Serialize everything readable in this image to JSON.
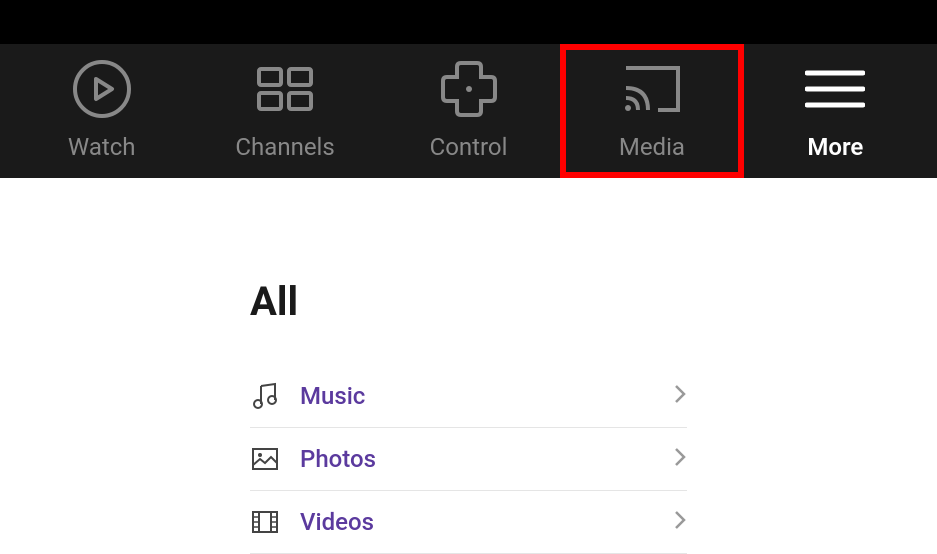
{
  "nav": {
    "items": [
      {
        "label": "Watch",
        "icon": "play-circle-icon"
      },
      {
        "label": "Channels",
        "icon": "grid-icon"
      },
      {
        "label": "Control",
        "icon": "dpad-icon"
      },
      {
        "label": "Media",
        "icon": "cast-icon",
        "highlighted": true
      },
      {
        "label": "More",
        "icon": "hamburger-icon",
        "active": true
      }
    ]
  },
  "content": {
    "section_title": "All",
    "list": [
      {
        "label": "Music",
        "icon": "music-icon"
      },
      {
        "label": "Photos",
        "icon": "photo-icon"
      },
      {
        "label": "Videos",
        "icon": "video-icon"
      }
    ]
  },
  "colors": {
    "accent": "#5b3a9e",
    "highlight": "#ff0000"
  }
}
